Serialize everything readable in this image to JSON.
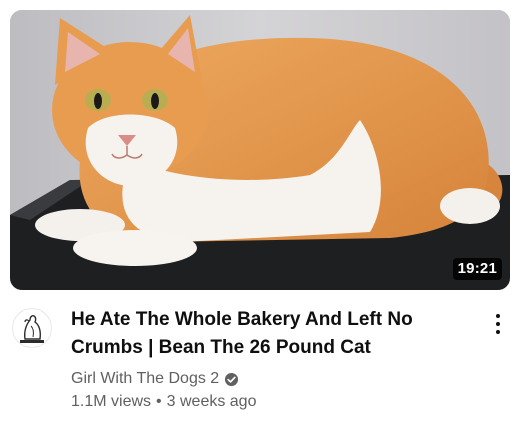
{
  "video": {
    "duration": "19:21",
    "title": "He Ate The Whole Bakery And Left No Crumbs | Bean The 26 Pound Cat",
    "channel": "Girl With The Dogs 2",
    "views": "1.1M views",
    "separator": "•",
    "age": "3 weeks ago"
  },
  "icons": {
    "verified": "verified-check-icon",
    "menu": "more-vert-icon",
    "avatar": "dog-logo-avatar"
  },
  "colors": {
    "title": "#0f0f0f",
    "secondary_text": "#606060",
    "duration_badge": "#000000",
    "cat_orange": "#e3954a",
    "cat_white": "#f6f3ee"
  }
}
